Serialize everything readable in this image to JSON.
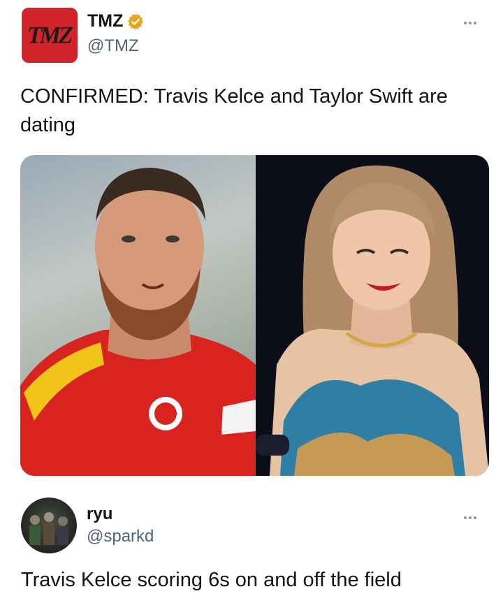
{
  "main_tweet": {
    "logo_text": "TMZ",
    "author_name": "TMZ",
    "author_handle": "@TMZ",
    "verified_color": "#e8a318",
    "text": "CONFIRMED: Travis Kelce and Taylor Swift are dating",
    "media_icons": [
      "person-photo-left",
      "person-photo-right"
    ]
  },
  "reply": {
    "author_name": "ryu",
    "author_handle": "@sparkd",
    "text": "Travis Kelce scoring 6s on and off the field"
  }
}
